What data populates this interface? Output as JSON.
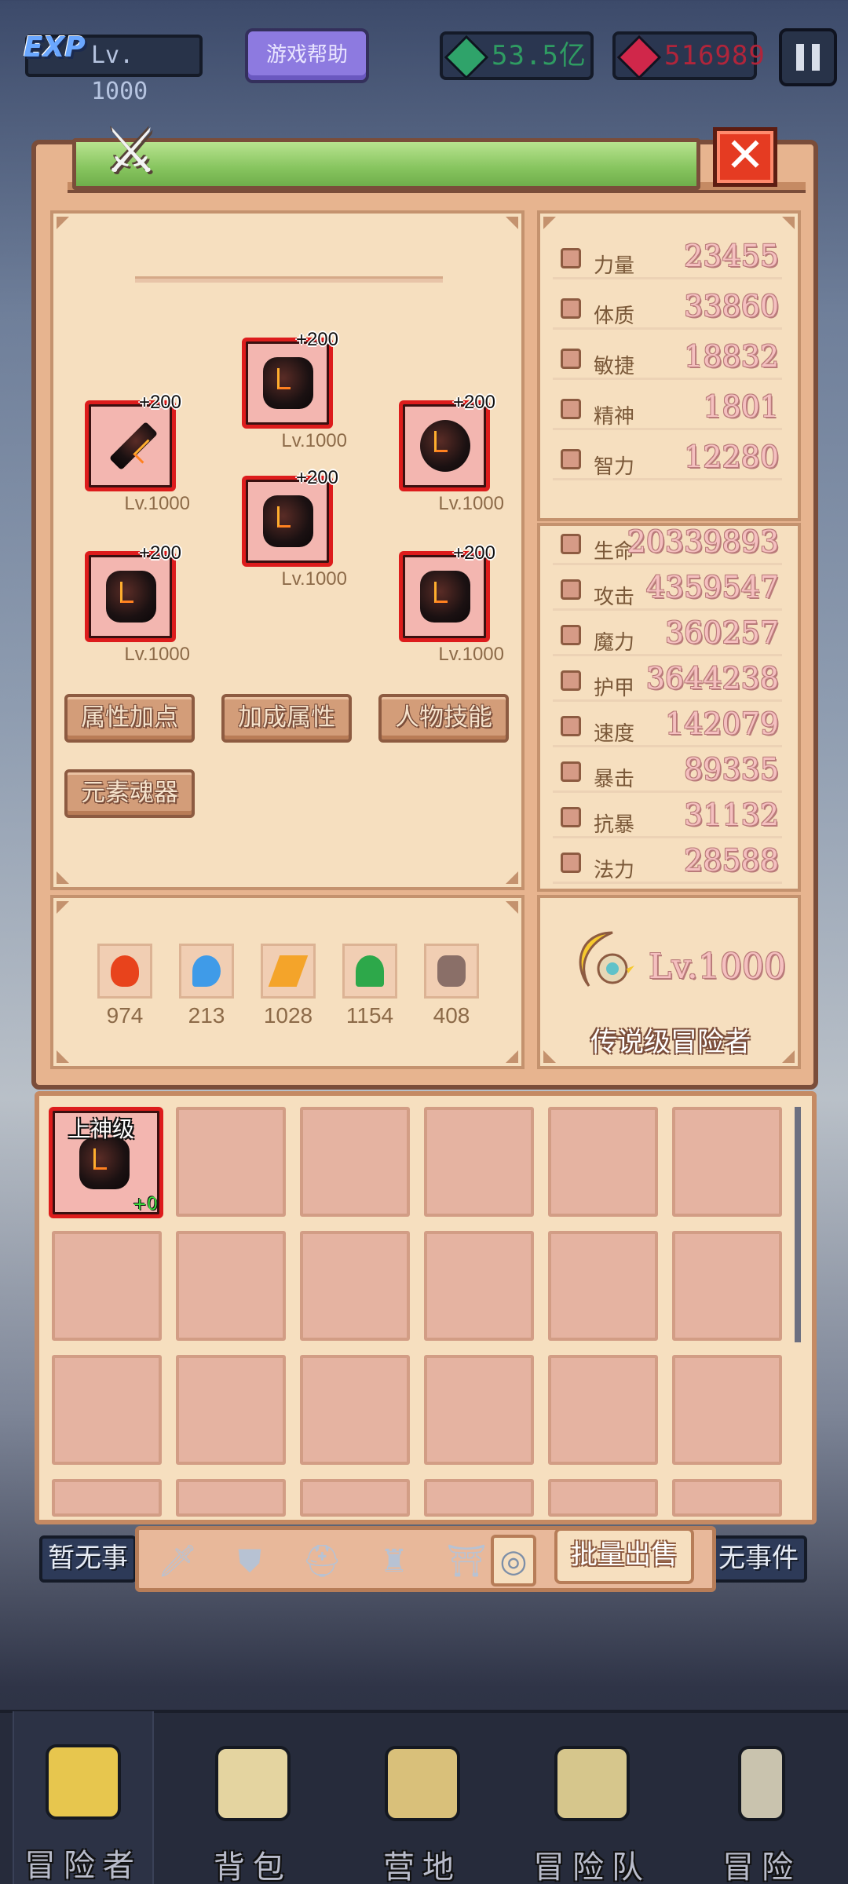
{
  "hud": {
    "exp_logo": "EXP",
    "level": "Lv. 1000",
    "help_label": "游戏帮助",
    "green_currency": "53.5亿",
    "red_currency": "516989"
  },
  "equipment": {
    "slots": [
      {
        "plus": "+200",
        "lv": "Lv.1000",
        "icon": "helmet-icon"
      },
      {
        "plus": "+200",
        "lv": "Lv.1000",
        "icon": "sword-icon"
      },
      {
        "plus": "+200",
        "lv": "Lv.1000",
        "icon": "shield-icon"
      },
      {
        "plus": "+200",
        "lv": "Lv.1000",
        "icon": "armor-icon"
      },
      {
        "plus": "+200",
        "lv": "Lv.1000",
        "icon": "gauntlet-icon"
      },
      {
        "plus": "+200",
        "lv": "Lv.1000",
        "icon": "boots-icon"
      }
    ],
    "buttons": [
      "属性加点",
      "加成属性",
      "人物技能",
      "元素魂器"
    ]
  },
  "elements": [
    {
      "icon": "fire-icon",
      "color": "#e8431c",
      "value": "974"
    },
    {
      "icon": "water-icon",
      "color": "#3f9be8",
      "value": "213"
    },
    {
      "icon": "lightning-icon",
      "color": "#f4a42a",
      "value": "1028"
    },
    {
      "icon": "wind-icon",
      "color": "#2da84a",
      "value": "1154"
    },
    {
      "icon": "skull-icon",
      "color": "#8a6f68",
      "value": "408"
    }
  ],
  "base_stats": [
    {
      "label": "力量",
      "value": "23455"
    },
    {
      "label": "体质",
      "value": "33860"
    },
    {
      "label": "敏捷",
      "value": "18832"
    },
    {
      "label": "精神",
      "value": "1801"
    },
    {
      "label": "智力",
      "value": "12280"
    }
  ],
  "combat_stats": [
    {
      "label": "生命",
      "value": "20339893"
    },
    {
      "label": "攻击",
      "value": "4359547"
    },
    {
      "label": "魔力",
      "value": "360257"
    },
    {
      "label": "护甲",
      "value": "3644238"
    },
    {
      "label": "速度",
      "value": "142079"
    },
    {
      "label": "暴击",
      "value": "89335"
    },
    {
      "label": "抗暴",
      "value": "31132"
    },
    {
      "label": "法力",
      "value": "28588"
    }
  ],
  "rank": {
    "level": "Lv.1000",
    "title": "传说级冒险者"
  },
  "inventory": {
    "item": {
      "tier": "上神级",
      "plus": "+0"
    }
  },
  "filter_bar": {
    "left_tag": "暂无事",
    "right_tag": "无事件",
    "sell_label": "批量出售",
    "filters": [
      "sword-icon",
      "shield-icon",
      "helmet-icon",
      "armor-icon",
      "boots-icon",
      "ring-icon"
    ]
  },
  "bottom_nav": [
    {
      "label": "冒险者",
      "icon": "adventurer-icon"
    },
    {
      "label": "背包",
      "icon": "backpack-icon"
    },
    {
      "label": "营地",
      "icon": "camp-icon"
    },
    {
      "label": "冒险队",
      "icon": "team-icon"
    },
    {
      "label": "冒险",
      "icon": "adventure-icon"
    }
  ]
}
